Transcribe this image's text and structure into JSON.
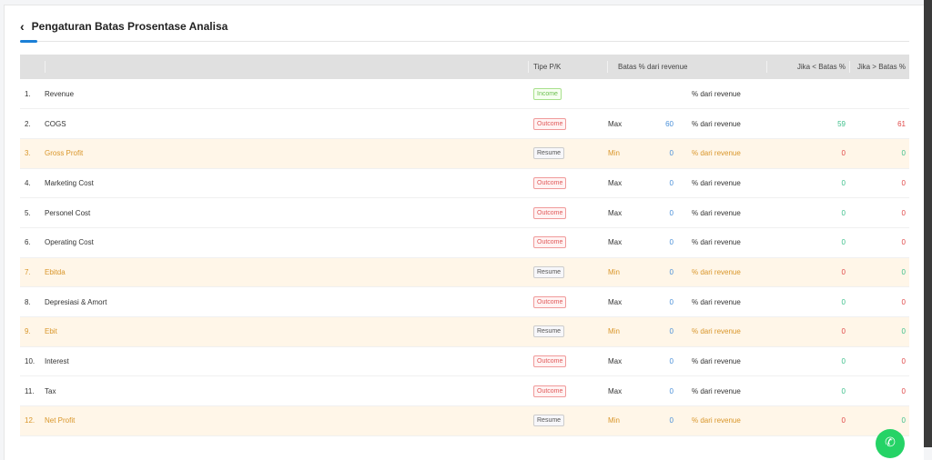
{
  "header": {
    "title": "Pengaturan Batas Prosentase Analisa"
  },
  "table": {
    "columns": [
      "",
      "",
      "Tipe P/K",
      "Batas % dari revenue",
      "",
      "Jika < Batas %",
      "Jika > Batas %"
    ],
    "rows": [
      {
        "no": "1.",
        "name": "Revenue",
        "type": "Income",
        "op": "",
        "limit": "",
        "unit": "% dari revenue",
        "below": "",
        "above": ""
      },
      {
        "no": "2.",
        "name": "COGS",
        "type": "Outcome",
        "op": "Max",
        "limit": "60",
        "unit": "% dari revenue",
        "below": "59",
        "above": "61"
      },
      {
        "no": "3.",
        "name": "Gross Profit",
        "type": "Resume",
        "op": "Min",
        "limit": "0",
        "unit": "% dari revenue",
        "below": "0",
        "above": "0"
      },
      {
        "no": "4.",
        "name": "Marketing Cost",
        "type": "Outcome",
        "op": "Max",
        "limit": "0",
        "unit": "% dari revenue",
        "below": "0",
        "above": "0"
      },
      {
        "no": "5.",
        "name": "Personel Cost",
        "type": "Outcome",
        "op": "Max",
        "limit": "0",
        "unit": "% dari revenue",
        "below": "0",
        "above": "0"
      },
      {
        "no": "6.",
        "name": "Operating Cost",
        "type": "Outcome",
        "op": "Max",
        "limit": "0",
        "unit": "% dari revenue",
        "below": "0",
        "above": "0"
      },
      {
        "no": "7.",
        "name": "Ebitda",
        "type": "Resume",
        "op": "Min",
        "limit": "0",
        "unit": "% dari revenue",
        "below": "0",
        "above": "0"
      },
      {
        "no": "8.",
        "name": "Depresiasi & Amort",
        "type": "Outcome",
        "op": "Max",
        "limit": "0",
        "unit": "% dari revenue",
        "below": "0",
        "above": "0"
      },
      {
        "no": "9.",
        "name": "Ebit",
        "type": "Resume",
        "op": "Min",
        "limit": "0",
        "unit": "% dari revenue",
        "below": "0",
        "above": "0"
      },
      {
        "no": "10.",
        "name": "Interest",
        "type": "Outcome",
        "op": "Max",
        "limit": "0",
        "unit": "% dari revenue",
        "below": "0",
        "above": "0"
      },
      {
        "no": "11.",
        "name": "Tax",
        "type": "Outcome",
        "op": "Max",
        "limit": "0",
        "unit": "% dari revenue",
        "below": "0",
        "above": "0"
      },
      {
        "no": "12.",
        "name": "Net Profit",
        "type": "Resume",
        "op": "Min",
        "limit": "0",
        "unit": "% dari revenue",
        "below": "0",
        "above": "0"
      }
    ]
  }
}
